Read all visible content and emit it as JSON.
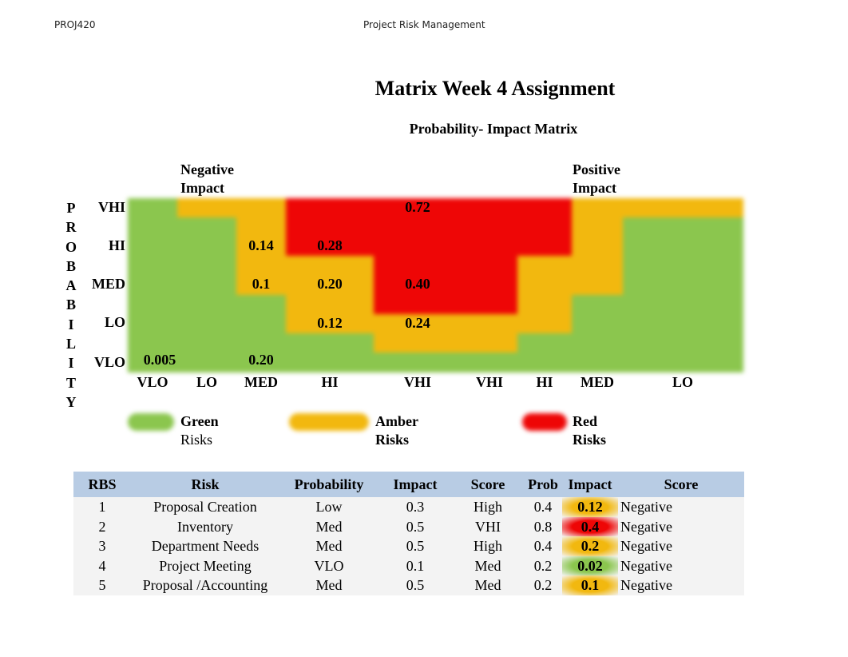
{
  "header": {
    "left": "PROJ420",
    "center": "Project Risk Management"
  },
  "title": "Matrix Week 4 Assignment",
  "matrix_title": "Probability- Impact Matrix",
  "negative_label": [
    "Negative",
    "Impact"
  ],
  "positive_label": [
    "Positive",
    "Impact"
  ],
  "probability_vertical": [
    "P",
    "R",
    "O",
    "B",
    "A",
    "B",
    "I",
    "L",
    "I",
    "T",
    "Y"
  ],
  "row_labels": [
    "VHI",
    "HI",
    "MED",
    "LO",
    "VLO"
  ],
  "column_labels": [
    "VLO",
    "LO",
    "MED",
    "HI",
    "VHI",
    "VHI",
    "HI",
    "MED",
    "LO"
  ],
  "colors": {
    "green": "#8bc64e",
    "amber": "#f2b80f",
    "red": "#ee0606",
    "header_blue": "#b8cce4"
  },
  "grid": [
    [
      "G",
      "A",
      "A",
      "R",
      "R",
      "R",
      "R",
      "A",
      "A"
    ],
    [
      "G",
      "G",
      "A",
      "R",
      "R",
      "R",
      "R",
      "A",
      "G"
    ],
    [
      "G",
      "G",
      "A",
      "R",
      "R",
      "R",
      "R",
      "A",
      "G"
    ],
    [
      "G",
      "G",
      "A",
      "A",
      "R",
      "R",
      "A",
      "A",
      "G"
    ],
    [
      "G",
      "G",
      "A",
      "A",
      "R",
      "R",
      "A",
      "A",
      "G"
    ],
    [
      "G",
      "G",
      "G",
      "A",
      "R",
      "R",
      "A",
      "G",
      "G"
    ],
    [
      "G",
      "G",
      "G",
      "A",
      "A",
      "A",
      "A",
      "G",
      "G"
    ],
    [
      "G",
      "G",
      "G",
      "G",
      "A",
      "A",
      "G",
      "G",
      "G"
    ],
    [
      "G",
      "G",
      "G",
      "G",
      "G",
      "G",
      "G",
      "G",
      "G"
    ]
  ],
  "cell_values": [
    {
      "row": 0,
      "col": 4,
      "value": "0.72"
    },
    {
      "row": 2,
      "col": 2,
      "value": "0.14"
    },
    {
      "row": 2,
      "col": 3,
      "value": "0.28"
    },
    {
      "row": 4,
      "col": 2,
      "value": "0.1"
    },
    {
      "row": 4,
      "col": 3,
      "value": "0.20"
    },
    {
      "row": 4,
      "col": 4,
      "value": "0.40"
    },
    {
      "row": 6,
      "col": 3,
      "value": "0.12"
    },
    {
      "row": 6,
      "col": 4,
      "value": "0.24"
    },
    {
      "row": 8,
      "col": 0,
      "value": "0.005"
    },
    {
      "row": 8,
      "col": 2,
      "value": "0.20"
    }
  ],
  "legend": [
    {
      "color": "green",
      "line1": "Green",
      "line2": "Risks"
    },
    {
      "color": "amber",
      "line1": "Amber",
      "line2": "Risks"
    },
    {
      "color": "red",
      "line1": "Red",
      "line2": "Risks"
    }
  ],
  "table": {
    "headers": [
      "RBS",
      "Risk",
      "Probability",
      "Impact",
      "Score",
      "Prob",
      "Impact",
      "Score"
    ],
    "rows": [
      {
        "rbs": "1",
        "risk": "Proposal Creation",
        "probability": "Low",
        "impact": "0.3",
        "score": "High",
        "prob": "0.4",
        "impact_score": "0.12",
        "impact_color": "amber",
        "type": "Negative"
      },
      {
        "rbs": "2",
        "risk": "Inventory",
        "probability": "Med",
        "impact": "0.5",
        "score": "VHI",
        "prob": "0.8",
        "impact_score": "0.4",
        "impact_color": "red",
        "type": "Negative"
      },
      {
        "rbs": "3",
        "risk": "Department Needs",
        "probability": "Med",
        "impact": "0.5",
        "score": "High",
        "prob": "0.4",
        "impact_score": "0.2",
        "impact_color": "amber",
        "type": "Negative"
      },
      {
        "rbs": "4",
        "risk": "Project Meeting",
        "probability": "VLO",
        "impact": "0.1",
        "score": "Med",
        "prob": "0.2",
        "impact_score": "0.02",
        "impact_color": "green",
        "type": "Negative"
      },
      {
        "rbs": "5",
        "risk": "Proposal /Accounting",
        "probability": "Med",
        "impact": "0.5",
        "score": "Med",
        "prob": "0.2",
        "impact_score": "0.1",
        "impact_color": "amber",
        "type": "Negative"
      }
    ]
  }
}
